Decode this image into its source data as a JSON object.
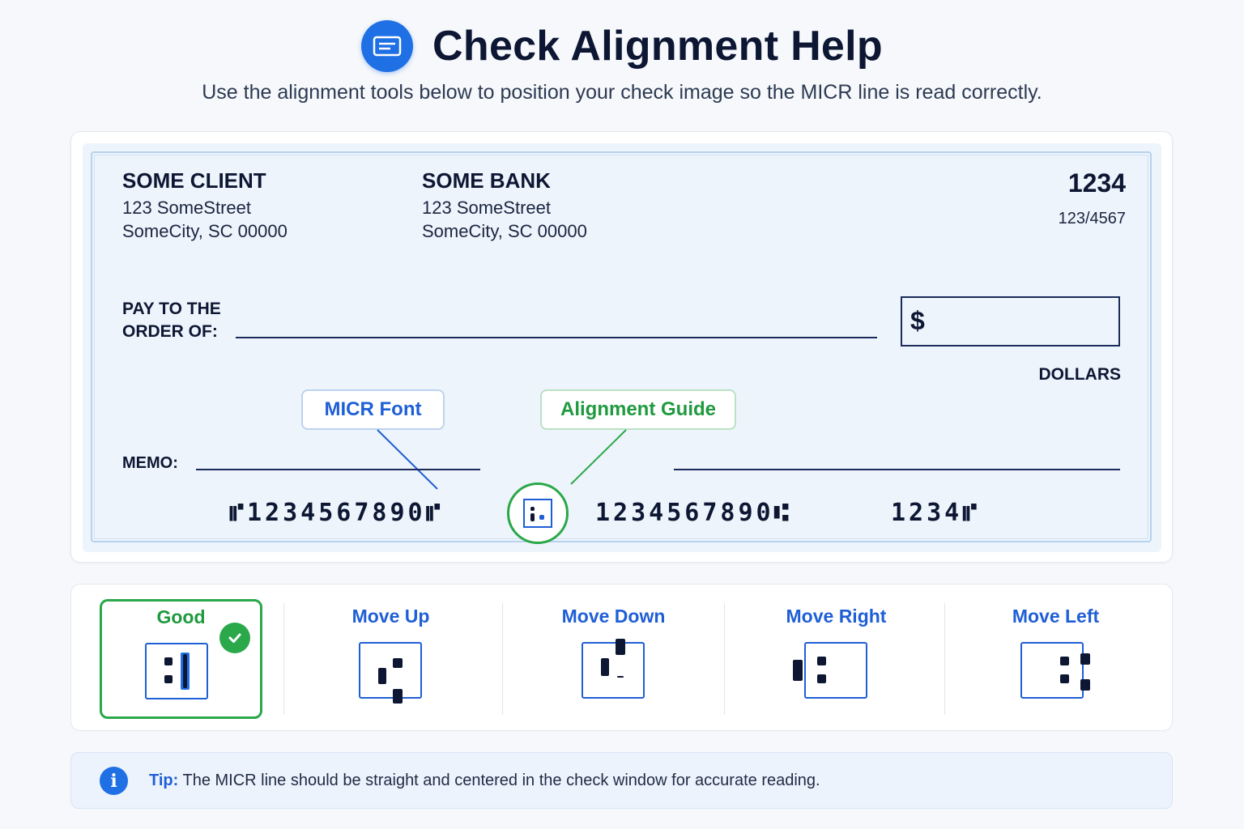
{
  "header": {
    "icon": "check-card-icon",
    "title": "Check Alignment Help",
    "subtitle": "Use the alignment tools below to position your check image so the MICR line is read correctly."
  },
  "check": {
    "client": {
      "name": "SOME CLIENT",
      "address1": "123 SomeStreet",
      "address2": "SomeCity, SC 00000"
    },
    "bank": {
      "name": "SOME BANK",
      "address1": "123 SomeStreet",
      "address2": "SomeCity, SC 00000"
    },
    "number": "1234",
    "routing_fraction": "123/4567",
    "pay_label_line1": "PAY TO THE",
    "pay_label_line2": "ORDER OF:",
    "currency_symbol": "$",
    "dollars_label": "DOLLARS",
    "memo_label": "MEMO:",
    "micr": {
      "routing": "⑈1234567890⑈",
      "account": "1234567890⑆",
      "check": "1234⑈"
    }
  },
  "callouts": {
    "micr_font": "MICR Font",
    "alignment_guide": "Alignment Guide"
  },
  "options": [
    {
      "label": "Good",
      "icon": "aligned-icon",
      "selected": true
    },
    {
      "label": "Move Up",
      "icon": "move-up-icon"
    },
    {
      "label": "Move Down",
      "icon": "move-down-icon"
    },
    {
      "label": "Move Right",
      "icon": "move-right-icon"
    },
    {
      "label": "Move Left",
      "icon": "move-left-icon"
    }
  ],
  "tip": {
    "label": "Tip:",
    "text": " The MICR line should be straight and centered in the check window for accurate reading."
  },
  "colors": {
    "accent_blue": "#1f6fe5",
    "success_green": "#2aa84a",
    "text_dark": "#0d1733"
  }
}
